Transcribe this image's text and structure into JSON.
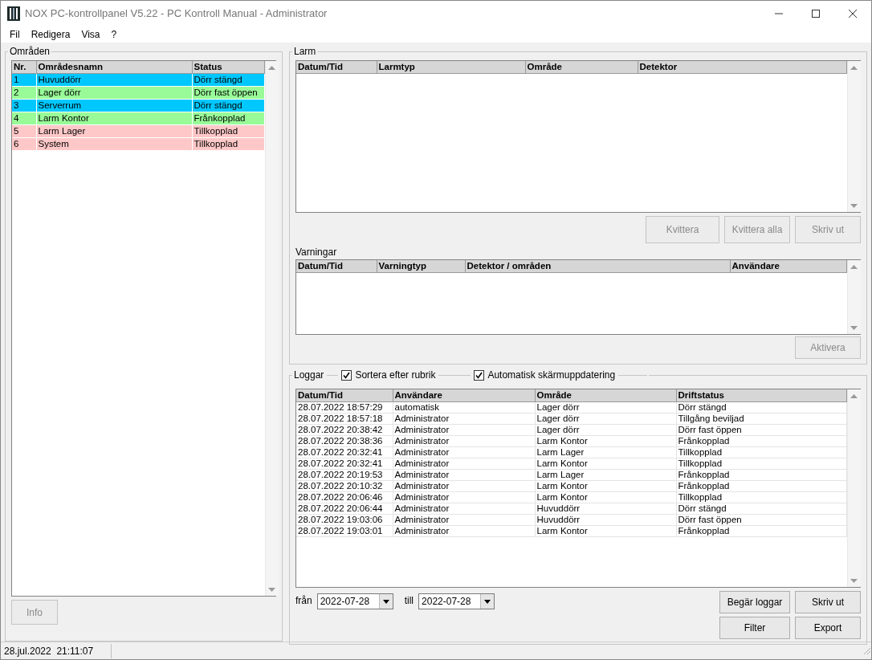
{
  "window": {
    "title": "NOX PC-kontrollpanel V5.22 - PC Kontroll Manual - Administrator"
  },
  "menu": [
    "Fil",
    "Redigera",
    "Visa",
    "?"
  ],
  "areas": {
    "title": "Områden",
    "columns": [
      "Nr.",
      "Områdesnamn",
      "Status"
    ],
    "rows": [
      {
        "nr": "1",
        "name": "Huvuddörr",
        "status": "Dörr stängd",
        "color": "#00c8ff"
      },
      {
        "nr": "2",
        "name": "Lager dörr",
        "status": "Dörr fast öppen",
        "color": "#98fb98"
      },
      {
        "nr": "3",
        "name": "Serverrum",
        "status": "Dörr stängd",
        "color": "#00c8ff"
      },
      {
        "nr": "4",
        "name": "Larm Kontor",
        "status": "Frånkopplad",
        "color": "#98fb98"
      },
      {
        "nr": "5",
        "name": "Larm Lager",
        "status": "Tillkopplad",
        "color": "#ffc8c8"
      },
      {
        "nr": "6",
        "name": "System",
        "status": "Tillkopplad",
        "color": "#ffc8c8"
      }
    ],
    "button": {
      "label": "Info",
      "disabled": true
    }
  },
  "alarms": {
    "title": "Larm",
    "columns": [
      "Datum/Tid",
      "Larmtyp",
      "Område",
      "Detektor"
    ],
    "buttons": [
      {
        "label": "Kvittera",
        "disabled": true
      },
      {
        "label": "Kvittera alla",
        "disabled": true
      },
      {
        "label": "Skriv ut",
        "disabled": true
      }
    ]
  },
  "warnings": {
    "title": "Varningar",
    "columns": [
      "Datum/Tid",
      "Varningtyp",
      "Detektor / områden",
      "Användare"
    ],
    "buttons": [
      {
        "label": "Aktivera",
        "disabled": true
      }
    ]
  },
  "logs": {
    "title": "Loggar",
    "checkboxes": [
      {
        "label": "Sortera efter rubrik",
        "checked": true
      },
      {
        "label": "Automatisk skärmuppdatering",
        "checked": true
      }
    ],
    "columns": [
      "Datum/Tid",
      "Användare",
      "Område",
      "Driftstatus"
    ],
    "rows": [
      [
        "28.07.2022 18:57:29",
        "automatisk",
        "Lager dörr",
        "Dörr stängd"
      ],
      [
        "28.07.2022 18:57:18",
        "Administrator",
        "Lager dörr",
        "Tillgång beviljad"
      ],
      [
        "28.07.2022 20:38:42",
        "Administrator",
        "Lager dörr",
        "Dörr fast öppen"
      ],
      [
        "28.07.2022 20:38:36",
        "Administrator",
        "Larm Kontor",
        "Frånkopplad"
      ],
      [
        "28.07.2022 20:32:41",
        "Administrator",
        "Larm Lager",
        "Tillkopplad"
      ],
      [
        "28.07.2022 20:32:41",
        "Administrator",
        "Larm Kontor",
        "Tillkopplad"
      ],
      [
        "28.07.2022 20:19:53",
        "Administrator",
        "Larm Lager",
        "Frånkopplad"
      ],
      [
        "28.07.2022 20:10:32",
        "Administrator",
        "Larm Kontor",
        "Frånkopplad"
      ],
      [
        "28.07.2022 20:06:46",
        "Administrator",
        "Larm Kontor",
        "Tillkopplad"
      ],
      [
        "28.07.2022 20:06:44",
        "Administrator",
        "Huvuddörr",
        "Dörr stängd"
      ],
      [
        "28.07.2022 19:03:06",
        "Administrator",
        "Huvuddörr",
        "Dörr fast öppen"
      ],
      [
        "28.07.2022 19:03:01",
        "Administrator",
        "Larm Kontor",
        "Frånkopplad"
      ]
    ],
    "from_label": "från",
    "from_value": "2022-07-28",
    "to_label": "till",
    "to_value": "2022-07-28",
    "buttons": [
      {
        "label": "Begär loggar",
        "disabled": false
      },
      {
        "label": "Skriv ut",
        "disabled": false
      },
      {
        "label": "Filter",
        "disabled": false
      },
      {
        "label": "Export",
        "disabled": false
      }
    ]
  },
  "status_bar": {
    "datetime": "28.jul.2022  21:11:07"
  }
}
